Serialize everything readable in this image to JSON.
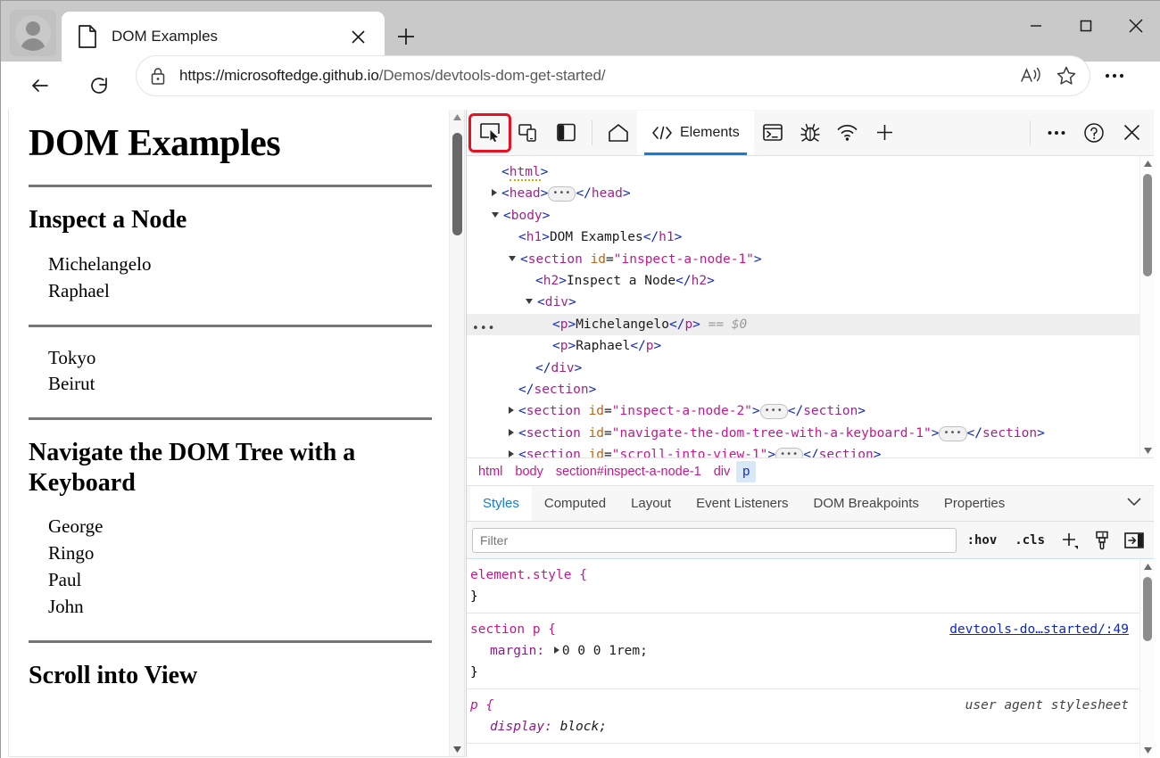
{
  "window": {
    "minimize": "–",
    "maximize": "□",
    "close": "✕"
  },
  "tabstrip": {
    "tab_title": "DOM Examples",
    "tab_close_label": "✕",
    "new_tab_label": "+"
  },
  "navbar": {
    "back_label": "←",
    "refresh_label": "⟳",
    "url_host": "https://microsoftedge.github.io",
    "url_path": "/Demos/devtools-dom-get-started/",
    "read_aloud_label": "A",
    "favorite_label": "☆",
    "more_label": "•••"
  },
  "page": {
    "title": "DOM Examples",
    "sections": [
      {
        "heading": "Inspect a Node",
        "groups": [
          [
            "Michelangelo",
            "Raphael"
          ],
          [
            "Tokyo",
            "Beirut"
          ]
        ]
      },
      {
        "heading": "Navigate the DOM Tree with a Keyboard",
        "groups": [
          [
            "George",
            "Ringo",
            "Paul",
            "John"
          ]
        ]
      },
      {
        "heading": "Scroll into View",
        "groups": []
      }
    ]
  },
  "devtools": {
    "toolbar": {
      "inspect_tool": "inspect-element-icon",
      "device_emulation": "device-emulation-icon",
      "dock_side": "dock-side-icon",
      "home": "home-icon",
      "elements_tab": "Elements",
      "console_icon": "console-icon",
      "sources_icon": "debugger-icon",
      "network_icon": "network-icon",
      "add_tool": "+",
      "more_tools": "•••",
      "help": "?",
      "close": "✕"
    },
    "dom_tree": [
      {
        "indent": 0,
        "caret": "none",
        "parts": [
          {
            "t": "tw",
            "s": "<"
          },
          {
            "t": "tn",
            "s": "html",
            "squiggle": true
          },
          {
            "t": "tw",
            "s": ">"
          }
        ]
      },
      {
        "indent": 0,
        "caret": "closed",
        "parts": [
          {
            "t": "tw",
            "s": "<"
          },
          {
            "t": "tn",
            "s": "head"
          },
          {
            "t": "tw",
            "s": ">"
          },
          {
            "t": "ellip",
            "s": "•••"
          },
          {
            "t": "tw",
            "s": "</"
          },
          {
            "t": "tn",
            "s": "head"
          },
          {
            "t": "tw",
            "s": ">"
          }
        ]
      },
      {
        "indent": 0,
        "caret": "open",
        "parts": [
          {
            "t": "tw",
            "s": "<"
          },
          {
            "t": "tn",
            "s": "body"
          },
          {
            "t": "tw",
            "s": ">"
          }
        ]
      },
      {
        "indent": 1,
        "caret": "none",
        "parts": [
          {
            "t": "tw",
            "s": "<"
          },
          {
            "t": "tn",
            "s": "h1"
          },
          {
            "t": "tw",
            "s": ">"
          },
          {
            "t": "tt",
            "s": "DOM Examples"
          },
          {
            "t": "tw",
            "s": "</"
          },
          {
            "t": "tn",
            "s": "h1"
          },
          {
            "t": "tw",
            "s": ">"
          }
        ]
      },
      {
        "indent": 1,
        "caret": "open",
        "parts": [
          {
            "t": "tw",
            "s": "<"
          },
          {
            "t": "tn",
            "s": "section"
          },
          {
            "t": "sp",
            "s": " "
          },
          {
            "t": "ta",
            "s": "id"
          },
          {
            "t": "tt",
            "s": "="
          },
          {
            "t": "tv",
            "s": "\"inspect-a-node-1\""
          },
          {
            "t": "tw",
            "s": ">"
          }
        ]
      },
      {
        "indent": 2,
        "caret": "none",
        "parts": [
          {
            "t": "tw",
            "s": "<"
          },
          {
            "t": "tn",
            "s": "h2"
          },
          {
            "t": "tw",
            "s": ">"
          },
          {
            "t": "tt",
            "s": "Inspect a Node"
          },
          {
            "t": "tw",
            "s": "</"
          },
          {
            "t": "tn",
            "s": "h2"
          },
          {
            "t": "tw",
            "s": ">"
          }
        ]
      },
      {
        "indent": 2,
        "caret": "open",
        "parts": [
          {
            "t": "tw",
            "s": "<"
          },
          {
            "t": "tn",
            "s": "div"
          },
          {
            "t": "tw",
            "s": ">"
          }
        ]
      },
      {
        "indent": 3,
        "caret": "none",
        "selected": true,
        "rowdots": "•••",
        "parts": [
          {
            "t": "tw",
            "s": "<"
          },
          {
            "t": "tn",
            "s": "p"
          },
          {
            "t": "tw",
            "s": ">"
          },
          {
            "t": "tt",
            "s": "Michelangelo"
          },
          {
            "t": "tw",
            "s": "</"
          },
          {
            "t": "tn",
            "s": "p"
          },
          {
            "t": "tw",
            "s": ">"
          },
          {
            "t": "tg",
            "s": "  == $0"
          }
        ]
      },
      {
        "indent": 3,
        "caret": "none",
        "parts": [
          {
            "t": "tw",
            "s": "<"
          },
          {
            "t": "tn",
            "s": "p"
          },
          {
            "t": "tw",
            "s": ">"
          },
          {
            "t": "tt",
            "s": "Raphael"
          },
          {
            "t": "tw",
            "s": "</"
          },
          {
            "t": "tn",
            "s": "p"
          },
          {
            "t": "tw",
            "s": ">"
          }
        ]
      },
      {
        "indent": 2,
        "caret": "none",
        "parts": [
          {
            "t": "tw",
            "s": "</"
          },
          {
            "t": "tn",
            "s": "div"
          },
          {
            "t": "tw",
            "s": ">"
          }
        ]
      },
      {
        "indent": 1,
        "caret": "none",
        "parts": [
          {
            "t": "tw",
            "s": "</"
          },
          {
            "t": "tn",
            "s": "section"
          },
          {
            "t": "tw",
            "s": ">"
          }
        ]
      },
      {
        "indent": 1,
        "caret": "closed",
        "parts": [
          {
            "t": "tw",
            "s": "<"
          },
          {
            "t": "tn",
            "s": "section"
          },
          {
            "t": "sp",
            "s": " "
          },
          {
            "t": "ta",
            "s": "id"
          },
          {
            "t": "tt",
            "s": "="
          },
          {
            "t": "tv",
            "s": "\"inspect-a-node-2\""
          },
          {
            "t": "tw",
            "s": ">"
          },
          {
            "t": "ellip",
            "s": "•••"
          },
          {
            "t": "tw",
            "s": "</"
          },
          {
            "t": "tn",
            "s": "section"
          },
          {
            "t": "tw",
            "s": ">"
          }
        ]
      },
      {
        "indent": 1,
        "caret": "closed",
        "parts": [
          {
            "t": "tw",
            "s": "<"
          },
          {
            "t": "tn",
            "s": "section"
          },
          {
            "t": "sp",
            "s": " "
          },
          {
            "t": "ta",
            "s": "id"
          },
          {
            "t": "tt",
            "s": "="
          },
          {
            "t": "tv",
            "s": "\"navigate-the-dom-tree-with-a-keyboard-1\""
          },
          {
            "t": "tw",
            "s": ">"
          },
          {
            "t": "ellip",
            "s": "•••"
          },
          {
            "t": "tw",
            "s": "</"
          },
          {
            "t": "tn",
            "s": "section"
          },
          {
            "t": "tw",
            "s": ">"
          }
        ]
      },
      {
        "indent": 1,
        "caret": "closed",
        "parts": [
          {
            "t": "tw",
            "s": "<"
          },
          {
            "t": "tn",
            "s": "section"
          },
          {
            "t": "sp",
            "s": " "
          },
          {
            "t": "ta",
            "s": "id"
          },
          {
            "t": "tt",
            "s": "="
          },
          {
            "t": "tv",
            "s": "\"scroll-into-view-1\""
          },
          {
            "t": "tw",
            "s": ">"
          },
          {
            "t": "ellip",
            "s": "•••"
          },
          {
            "t": "tw",
            "s": "</"
          },
          {
            "t": "tn",
            "s": "section"
          },
          {
            "t": "tw",
            "s": ">"
          }
        ]
      }
    ],
    "breadcrumb": [
      {
        "label": "html",
        "selected": false
      },
      {
        "label": "body",
        "selected": false
      },
      {
        "label": "section#inspect-a-node-1",
        "selected": false
      },
      {
        "label": "div",
        "selected": false
      },
      {
        "label": "p",
        "selected": true
      }
    ],
    "subtabs": [
      {
        "label": "Styles",
        "active": true
      },
      {
        "label": "Computed",
        "active": false
      },
      {
        "label": "Layout",
        "active": false
      },
      {
        "label": "Event Listeners",
        "active": false
      },
      {
        "label": "DOM Breakpoints",
        "active": false
      },
      {
        "label": "Properties",
        "active": false
      }
    ],
    "subtabs_overflow": "⌄",
    "style_toolbar": {
      "filter_placeholder": "Filter",
      "filter_value": "",
      "hov_label": ":hov",
      "cls_label": ".cls",
      "new_rule_label": "+",
      "copy_styles_icon": "paintbrush-icon",
      "toggle_sidebar_icon": "open-in-pane-icon"
    },
    "style_rules": [
      {
        "selector": "element.style {",
        "close": "}",
        "origin": "",
        "origin_type": "none",
        "declarations": []
      },
      {
        "selector": "section p {",
        "close": "}",
        "origin": "devtools-do…started/:49",
        "origin_type": "link",
        "declarations": [
          {
            "prop": "margin:",
            "value": "0 0 0 1rem;",
            "has_triangle": true
          }
        ]
      },
      {
        "selector": "p {",
        "close": "",
        "origin": "user agent stylesheet",
        "origin_type": "ua",
        "ua": true,
        "declarations": [
          {
            "prop": "display:",
            "value": "block;",
            "has_triangle": false
          }
        ]
      }
    ]
  },
  "colors": {
    "accent_blue": "#0f7fd4",
    "highlight_red": "#e81123",
    "tag_name": "#a0248c",
    "attr_name": "#b8651b",
    "attr_value": "#c2188f",
    "bracket": "#0f26c2"
  }
}
